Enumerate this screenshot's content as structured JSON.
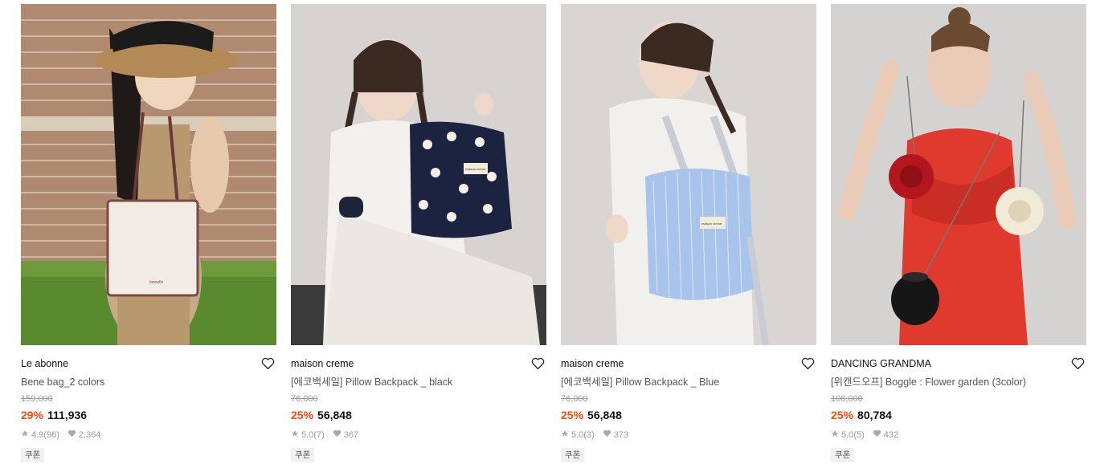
{
  "products": [
    {
      "brand": "Le abonne",
      "name": "Bene bag_2 colors",
      "original_price": "159,000",
      "discount": "29%",
      "price": "111,936",
      "rating": "4.9",
      "review_count": "(96)",
      "likes": "2,364",
      "coupon": "쿠폰",
      "bag_logo": "lanoelle"
    },
    {
      "brand": "maison creme",
      "name": "[에코백세일] Pillow Backpack _ black",
      "original_price": "76,000",
      "discount": "25%",
      "price": "56,848",
      "rating": "5.0",
      "review_count": "(7)",
      "likes": "367",
      "coupon": "쿠폰",
      "bag_logo": "maison creme"
    },
    {
      "brand": "maison creme",
      "name": "[에코백세일] Pillow Backpack _ Blue",
      "original_price": "76,000",
      "discount": "25%",
      "price": "56,848",
      "rating": "5.0",
      "review_count": "(3)",
      "likes": "373",
      "coupon": "쿠폰",
      "bag_logo": "maison creme"
    },
    {
      "brand": "DANCING GRANDMA",
      "name": "[위캔드오프] Boggle : Flower garden (3color)",
      "original_price": "108,000",
      "discount": "25%",
      "price": "80,784",
      "rating": "5.0",
      "review_count": "(5)",
      "likes": "432",
      "coupon": "쿠폰"
    }
  ],
  "colors": {
    "discount": "#ff4800",
    "muted": "#999999",
    "coupon_bg": "#f1f1f1"
  },
  "icons": {
    "wishlist": "heart-outline-icon",
    "rating": "star-icon",
    "likes": "heart-filled-icon"
  }
}
